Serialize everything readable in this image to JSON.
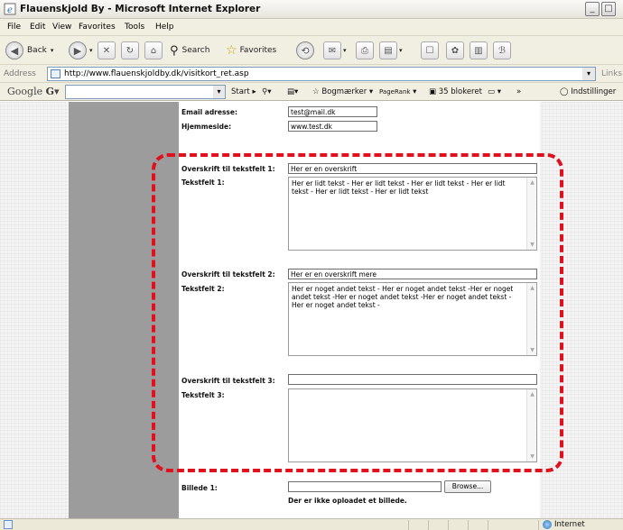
{
  "window": {
    "title": "Flauenskjold By - Microsoft Internet Explorer"
  },
  "menu": {
    "items": [
      "File",
      "Edit",
      "View",
      "Favorites",
      "Tools",
      "Help"
    ]
  },
  "toolbar": {
    "back": "Back",
    "search": "Search",
    "favorites": "Favorites"
  },
  "address": {
    "label": "Address",
    "url": "http://www.flauenskjoldby.dk/visitkort_ret.asp",
    "links": "Links"
  },
  "google": {
    "logo": "Google",
    "start": "Start",
    "bookmarks": "Bogmærker",
    "pagerank": "PageRank",
    "blocked": "35 blokeret",
    "settings": "Indstillinger"
  },
  "form": {
    "email_label": "Email adresse:",
    "email_value": "test@mail.dk",
    "homepage_label": "Hjemmeside:",
    "homepage_value": "www.test.dk",
    "heading1_label": "Overskrift til tekstfelt 1:",
    "heading1_value": "Her er en overskrift",
    "text1_label": "Tekstfelt 1:",
    "text1_value": "Her er lidt tekst - Her er lidt tekst - Her er lidt tekst - Her er lidt tekst - Her er lidt tekst - Her er lidt tekst",
    "heading2_label": "Overskrift til tekstfelt 2:",
    "heading2_value": "Her er en overskrift mere",
    "text2_label": "Tekstfelt 2:",
    "text2_value": "Her er noget andet tekst - Her er noget andet tekst -Her er noget andet tekst -Her er noget andet tekst -Her er noget andet tekst -Her er noget andet tekst -",
    "heading3_label": "Overskrift til tekstfelt 3:",
    "heading3_value": "",
    "text3_label": "Tekstfelt 3:",
    "text3_value": "",
    "image_label": "Billede 1:",
    "browse_label": "Browse...",
    "image_note": "Der er ikke oploadet et billede."
  },
  "status": {
    "zone": "Internet"
  },
  "colors": {
    "highlight": "#e0101c",
    "gray_column": "#9c9c9c"
  }
}
